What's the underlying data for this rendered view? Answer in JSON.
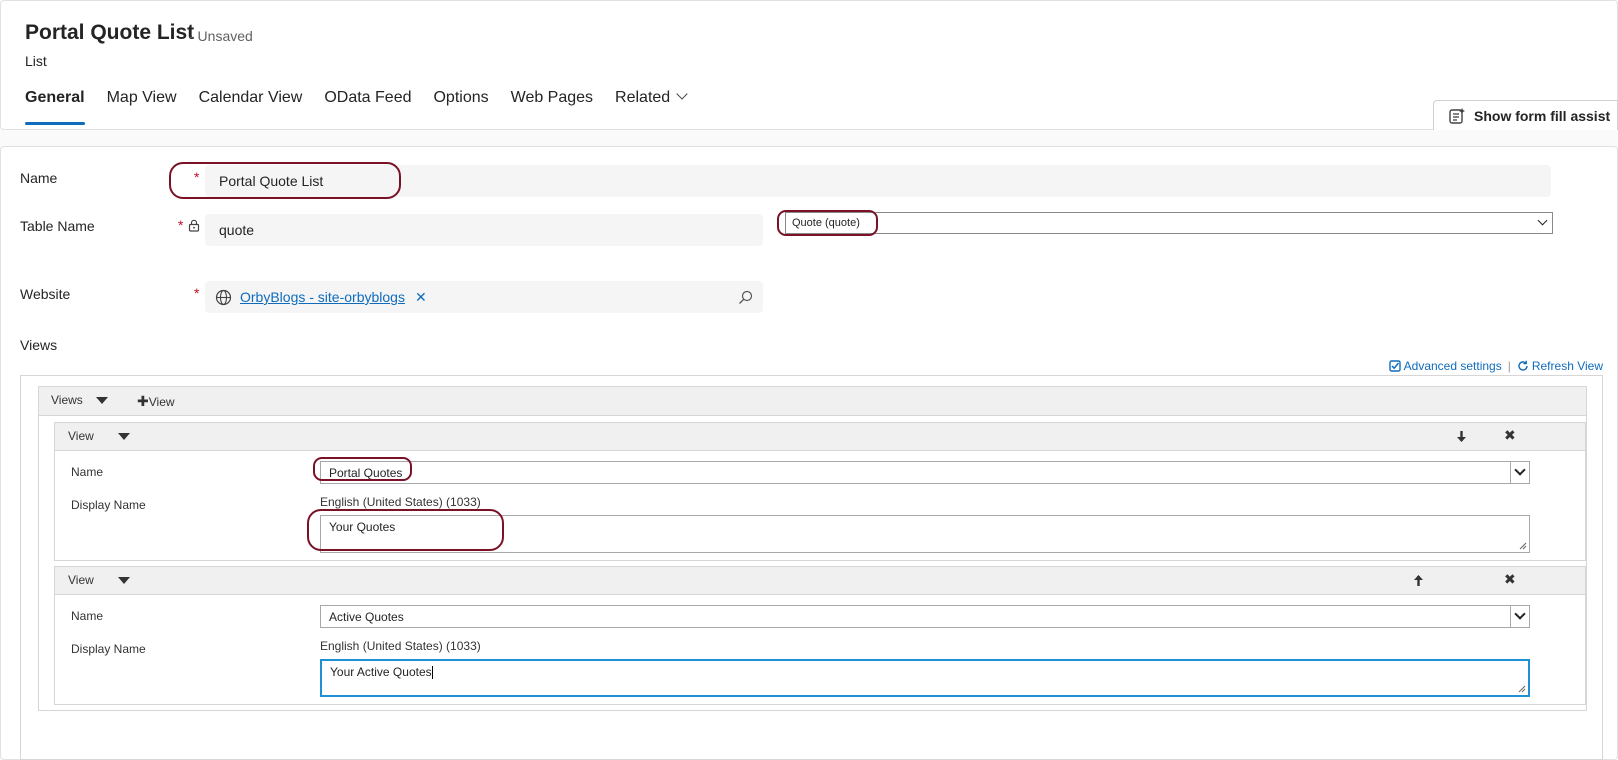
{
  "header": {
    "title": "Portal Quote List",
    "status": "- Unsaved",
    "entity": "List",
    "tabs": [
      "General",
      "Map View",
      "Calendar View",
      "OData Feed",
      "Options",
      "Web Pages",
      "Related"
    ],
    "assist_label": "Show form fill assist"
  },
  "form": {
    "name_label": "Name",
    "name_value": "Portal Quote List",
    "table_label": "Table Name",
    "table_value": "quote",
    "table_select": "Quote (quote)",
    "website_label": "Website",
    "website_value": "OrbyBlogs - site-orbyblogs",
    "views_label": "Views",
    "advanced_settings": "Advanced settings",
    "refresh_view": "Refresh View"
  },
  "views_editor": {
    "toolbar_label": "Views",
    "add_label": "View",
    "items": [
      {
        "head": "View",
        "name_label": "Name",
        "name_value": "Portal Quotes",
        "display_label": "Display Name",
        "language": "English (United States) (1033)",
        "display_value": "Your Quotes"
      },
      {
        "head": "View",
        "name_label": "Name",
        "name_value": "Active Quotes",
        "display_label": "Display Name",
        "language": "English (United States) (1033)",
        "display_value": "Your Active Quotes"
      }
    ]
  },
  "colors": {
    "accent": "#0f6cbd",
    "required": "#c50f1f",
    "callout": "#7a1227",
    "focus": "#1e90d6"
  }
}
